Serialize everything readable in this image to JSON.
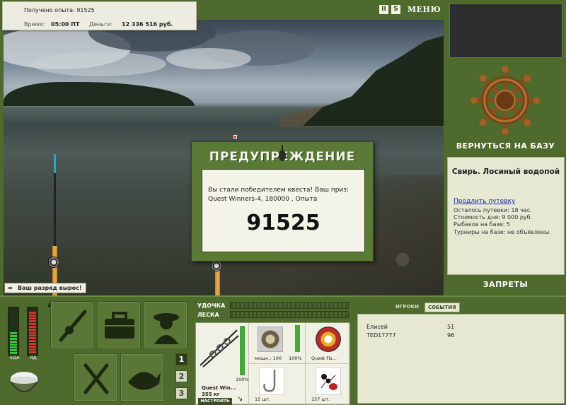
{
  "info": {
    "experience_text": "Получено опыта: 91525",
    "time_label": "Время:",
    "time_value": "05:00 ПТ",
    "money_label": "Деньги:",
    "money_value": "12 336 516 руб."
  },
  "top_buttons": {
    "pause": "II",
    "sound": "S",
    "menu": "МЕНЮ"
  },
  "right_panel": {
    "back_to_base": "ВЕРНУТЬСЯ НА БАЗУ",
    "location_title": "Свирь. Лосиный водопой",
    "extend_link": "Продлить путевку",
    "lines": [
      "Осталось путевки: 18 час.",
      "Стоимость дня: 9 000 руб.",
      "Рыбаков на базе: 5",
      "Турниры на базе: не объявлены"
    ],
    "bans": "ЗАПРЕТЫ"
  },
  "dialog": {
    "title": "ПРЕДУПРЕЖДЕНИЕ",
    "message": "Вы стали победителем квеста! Ваш приз: Quest Winners-4, 180000 , Опыта",
    "number": "91525"
  },
  "rank_badge": "Ваш разряд вырос!",
  "meters": {
    "food_label": "ЕДА",
    "poison_label": "ЯД",
    "food_level": 0.45,
    "poison_level": 0.88,
    "food_color": "#3ec040",
    "poison_color": "#d8322a"
  },
  "page_buttons": [
    "1",
    "2",
    "3"
  ],
  "tackle": {
    "rod_label": "УДОЧКА",
    "line_label": "ЛЕСКА",
    "rod_percent": "100%",
    "rod_name": "Quest Win...",
    "rod_weight": "355 кг",
    "setup_button": "НАСТРОИТЬ",
    "reel_power": "мощн.: 100",
    "reel_percent": "100%",
    "line_name": "Quest Fis...",
    "hook_count": "15 шт.",
    "bait_count": "157 шт."
  },
  "players": {
    "tabs": [
      "ИГРОКИ",
      "СОБЫТИЯ"
    ],
    "rows": [
      {
        "name": "Елисей",
        "score": "51"
      },
      {
        "name": "TED17777",
        "score": "96"
      }
    ]
  },
  "colors": {
    "panel": "#4e6a2c",
    "dialog": "#5a7a36",
    "accent_green": "#45a83a"
  }
}
